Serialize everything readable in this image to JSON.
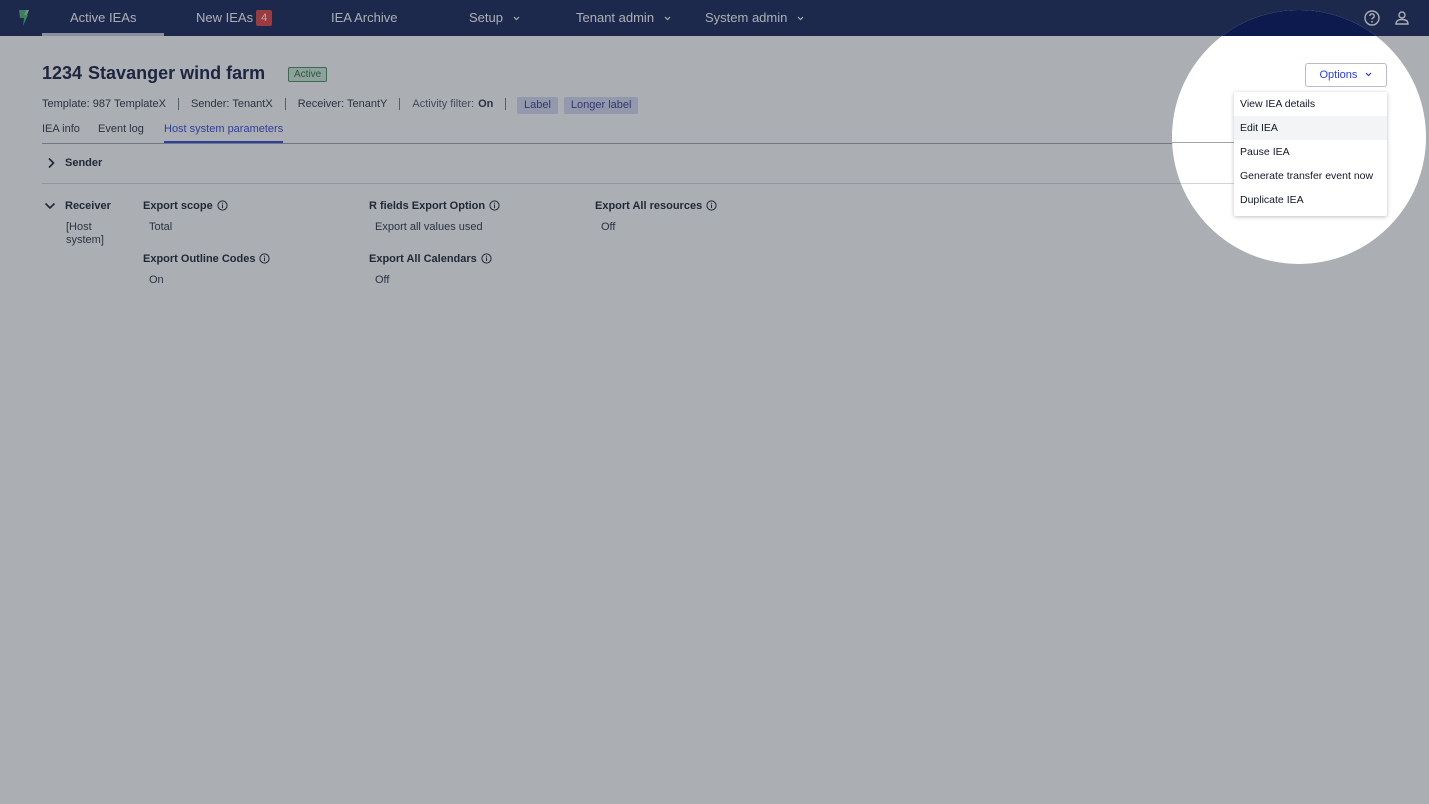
{
  "nav": {
    "items": [
      {
        "label": "Active IEAs"
      },
      {
        "label": "New IEAs",
        "badge": "4"
      },
      {
        "label": "IEA Archive"
      },
      {
        "label": "Setup"
      },
      {
        "label": "Tenant admin"
      },
      {
        "label": "System admin"
      }
    ],
    "icons": [
      "logo-icon",
      "help-icon",
      "user-icon"
    ]
  },
  "header": {
    "id": "1234",
    "name": "Stavanger wind farm",
    "status": "Active",
    "meta": {
      "template": "Template: 987 TemplateX",
      "sender": "Sender: TenantX",
      "receiver": "Receiver: TenantY",
      "activity_label": "Activity filter:",
      "activity_value": "On"
    },
    "chips": [
      "Label",
      "Longer label"
    ]
  },
  "tabs": [
    "IEA info",
    "Event log",
    "Host system parameters"
  ],
  "sections": {
    "sender": {
      "title": "Sender"
    },
    "receiver": {
      "title": "Receiver",
      "subtitle": "[Host system]",
      "fields": [
        {
          "label": "Export scope",
          "value": "Total"
        },
        {
          "label": "R fields Export Option",
          "value": "Export all values used"
        },
        {
          "label": "Export All resources",
          "value": "Off"
        },
        {
          "label": "Export Outline Codes",
          "value": "On"
        },
        {
          "label": "Export All Calendars",
          "value": "Off"
        }
      ]
    }
  },
  "options": {
    "label": "Options",
    "menu": [
      "View IEA details",
      "Edit IEA",
      "Pause IEA",
      "Generate transfer event now",
      "Duplicate IEA"
    ]
  },
  "colors": {
    "nav_bg": "#0c1a4e",
    "accent": "#2b3fd6",
    "badge": "#e23a3a",
    "status_bg": "#cde9d6",
    "chip_bg": "#d7daf3"
  }
}
